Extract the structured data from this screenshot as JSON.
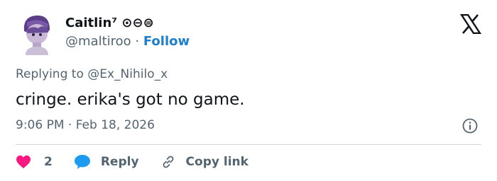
{
  "author": {
    "display_name": "Caitlin⁷ ⊙⊖⊜",
    "handle": "@maltiroo",
    "separator": "·",
    "follow_label": "Follow"
  },
  "tweet": {
    "replying_to": "Replying to @Ex_Nihilo_x",
    "text": "cringe. erika's got no game.",
    "timestamp": "9:06 PM · Feb 18, 2026"
  },
  "actions": {
    "like_count": "2",
    "reply_label": "Reply",
    "copy_link_label": "Copy link"
  },
  "icons": {
    "brand": "x-logo-icon",
    "info": "info-icon",
    "like": "heart-icon",
    "reply": "speech-bubble-icon",
    "copy": "link-icon"
  },
  "colors": {
    "follow": "#1d7fc9",
    "heart": "#f91880",
    "reply_bubble": "#1d9bf0",
    "secondary_text": "#536471"
  }
}
